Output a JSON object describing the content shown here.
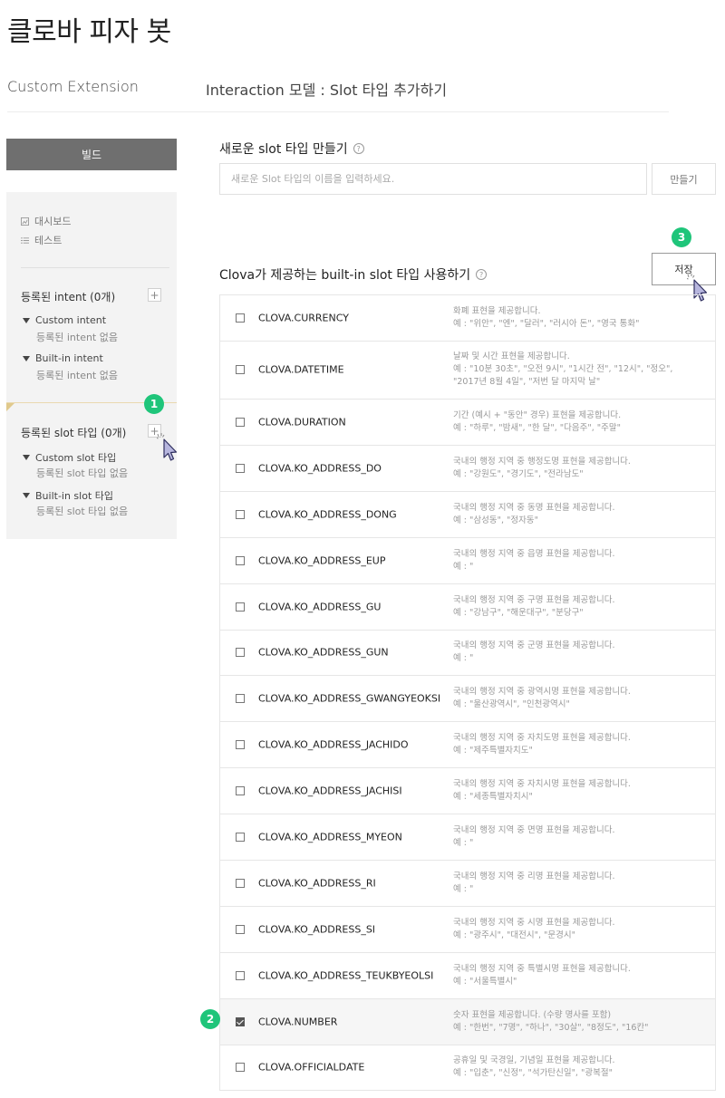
{
  "page": {
    "title": "클로바 피자 봇",
    "breadcrumb_left": "Custom Extension",
    "breadcrumb_right": "Interaction 모델 : Slot 타입 추가하기"
  },
  "sidebar": {
    "build_label": "빌드",
    "links": [
      {
        "label": "대시보드",
        "icon": "dashboard-icon"
      },
      {
        "label": "테스트",
        "icon": "list-icon"
      }
    ],
    "intents": {
      "title": "등록된 intent (0개)",
      "add": "+",
      "groups": [
        {
          "label": "Custom intent",
          "empty": "등록된 intent 없음"
        },
        {
          "label": "Built-in intent",
          "empty": "등록된 intent 없음"
        }
      ]
    },
    "slots": {
      "title": "등록된 slot 타입 (0개)",
      "add": "+",
      "groups": [
        {
          "label": "Custom slot 타입",
          "empty": "등록된 slot 타입 없음"
        },
        {
          "label": "Built-in slot 타입",
          "empty": "등록된 slot 타입 없음"
        }
      ]
    }
  },
  "main": {
    "new_slot_label": "새로운 slot 타입 만들기",
    "new_slot_placeholder": "새로운 Slot 타입의 이름을 입력하세요.",
    "create_label": "만들기",
    "builtin_label": "Clova가 제공하는 built-in slot 타입 사용하기",
    "save_label": "저장",
    "help_glyph": "?"
  },
  "badges": [
    "1",
    "2",
    "3"
  ],
  "accent_color": "#1fc57a",
  "slot_types": [
    {
      "name": "CLOVA.CURRENCY",
      "desc": "화폐 표현을 제공합니다.",
      "example": "예 : \"위안\", \"엔\", \"달러\", \"러시아 돈\", \"영국 통화\"",
      "checked": false
    },
    {
      "name": "CLOVA.DATETIME",
      "desc": "날짜 및 시간 표현을 제공합니다.",
      "example": "예 : \"10분 30초\", \"오전 9시\", \"1시간 전\", \"12시\", \"정오\", \"2017년 8월 4일\", \"저번 달 마지막 날\"",
      "checked": false
    },
    {
      "name": "CLOVA.DURATION",
      "desc": "기간 (예시 + \"동안\" 경우) 표현을 제공합니다.",
      "example": "예 : \"하루\", \"밤새\", \"한 달\", \"다음주\", \"주말\"",
      "checked": false
    },
    {
      "name": "CLOVA.KO_ADDRESS_DO",
      "desc": "국내의 행정 지역 중 행정도명 표현을 제공합니다.",
      "example": "예 : \"강원도\", \"경기도\", \"전라남도\"",
      "checked": false
    },
    {
      "name": "CLOVA.KO_ADDRESS_DONG",
      "desc": "국내의 행정 지역 중 동명 표현을 제공합니다.",
      "example": "예 : \"삼성동\", \"정자동\"",
      "checked": false
    },
    {
      "name": "CLOVA.KO_ADDRESS_EUP",
      "desc": "국내의 행정 지역 중 읍명 표현을 제공합니다.",
      "example": "예 : \"",
      "checked": false
    },
    {
      "name": "CLOVA.KO_ADDRESS_GU",
      "desc": "국내의 행정 지역 중 구명 표현을 제공합니다.",
      "example": "예 : \"강남구\", \"해운대구\", \"분당구\"",
      "checked": false
    },
    {
      "name": "CLOVA.KO_ADDRESS_GUN",
      "desc": "국내의 행정 지역 중 군명 표현을 제공합니다.",
      "example": "예 : \"",
      "checked": false
    },
    {
      "name": "CLOVA.KO_ADDRESS_GWANGYEOKSI",
      "desc": "국내의 행정 지역 중 광역시명 표현을 제공합니다.",
      "example": "예 : \"울산광역시\", \"인천광역시\"",
      "checked": false
    },
    {
      "name": "CLOVA.KO_ADDRESS_JACHIDO",
      "desc": "국내의 행정 지역 중 자치도명 표현을 제공합니다.",
      "example": "예 : \"제주특별자치도\"",
      "checked": false
    },
    {
      "name": "CLOVA.KO_ADDRESS_JACHISI",
      "desc": "국내의 행정 지역 중 자치시명 표현을 제공합니다.",
      "example": "예 : \"세종특별자치시\"",
      "checked": false
    },
    {
      "name": "CLOVA.KO_ADDRESS_MYEON",
      "desc": "국내의 행정 지역 중 면명 표현을 제공합니다.",
      "example": "예 : \"",
      "checked": false
    },
    {
      "name": "CLOVA.KO_ADDRESS_RI",
      "desc": "국내의 행정 지역 중 리명 표현을 제공합니다.",
      "example": "예 : \"",
      "checked": false
    },
    {
      "name": "CLOVA.KO_ADDRESS_SI",
      "desc": "국내의 행정 지역 중 시명 표현을 제공합니다.",
      "example": "예 : \"광주시\", \"대전시\", \"문경시\"",
      "checked": false
    },
    {
      "name": "CLOVA.KO_ADDRESS_TEUKBYEOLSI",
      "desc": "국내의 행정 지역 중 특별시명 표현을 제공합니다.",
      "example": "예 : \"서울특별시\"",
      "checked": false
    },
    {
      "name": "CLOVA.NUMBER",
      "desc": "숫자 표현을 제공합니다. (수량 명사를 포함)",
      "example": "예 : \"한번\", \"7명\", \"하나\", \"30살\", \"8정도\", \"16칸\"",
      "checked": true
    },
    {
      "name": "CLOVA.OFFICIALDATE",
      "desc": "공휴일 및 국경일, 기념일 표현을 제공합니다.",
      "example": "예 : \"입춘\", \"신정\", \"석가탄신일\", \"광복절\"",
      "checked": false
    }
  ]
}
